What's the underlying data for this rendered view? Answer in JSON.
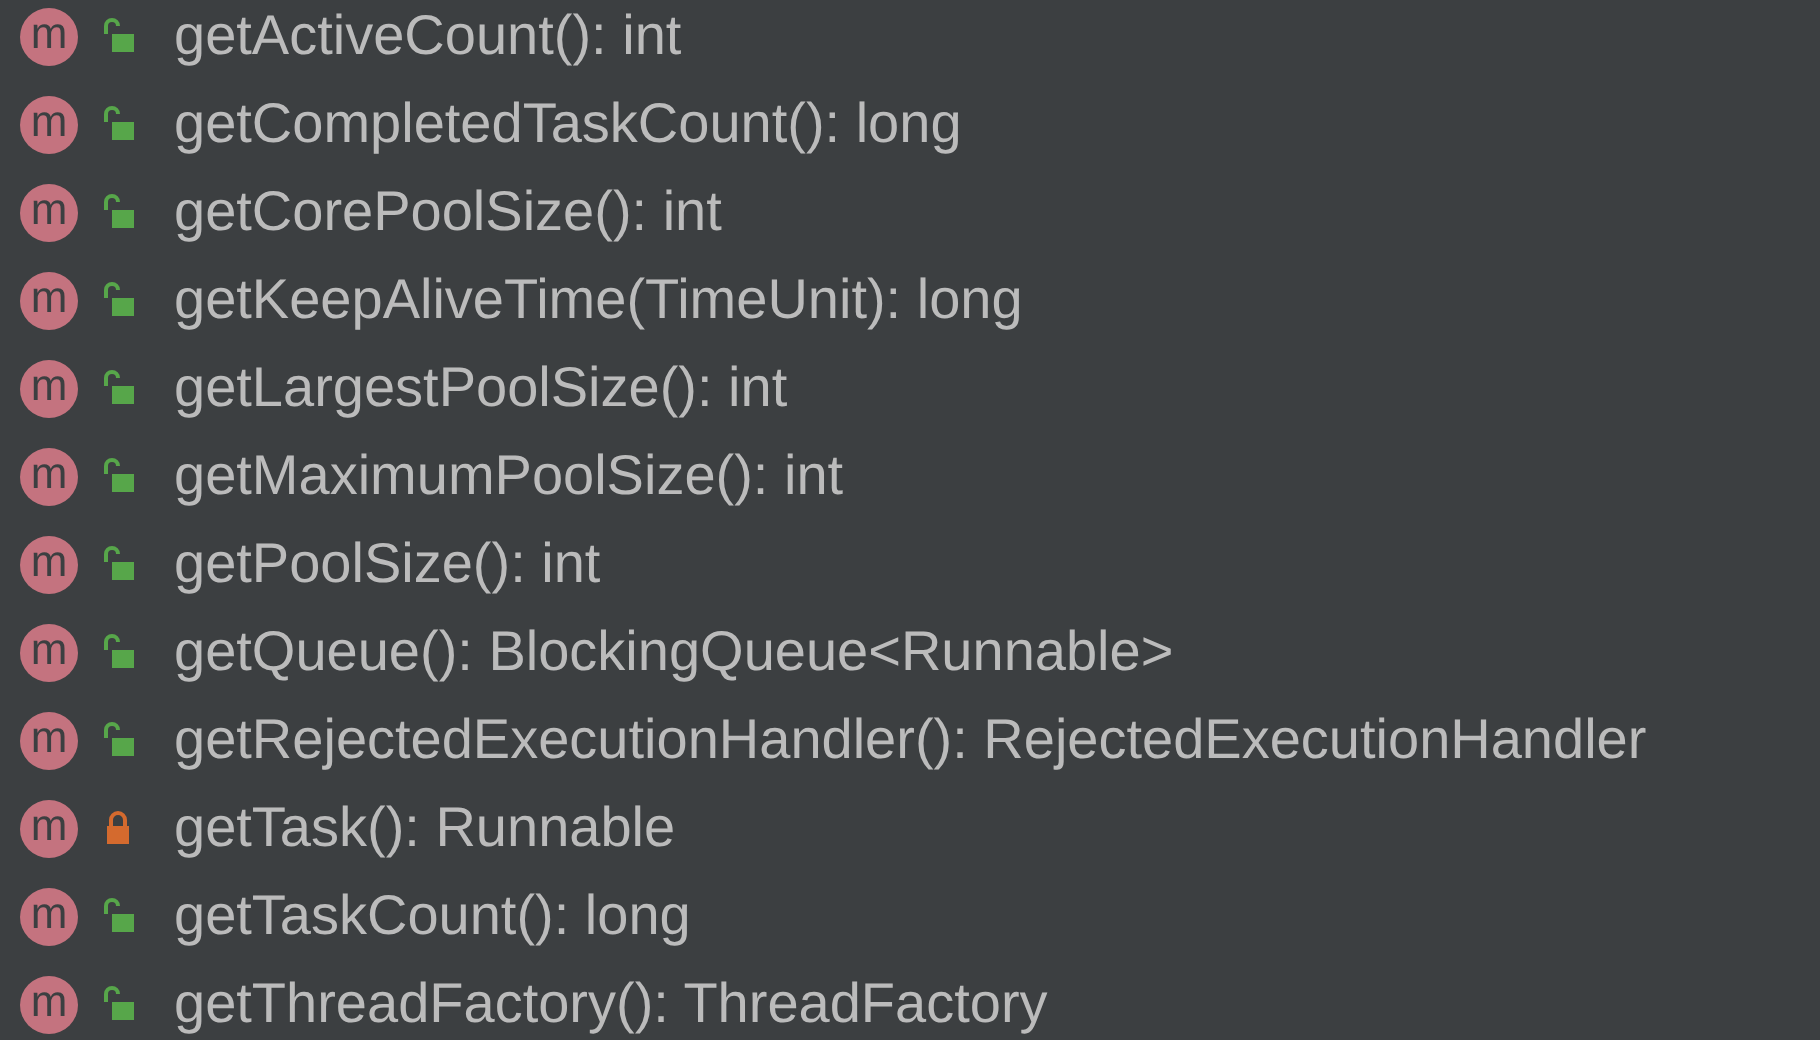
{
  "members": [
    {
      "badge": "m",
      "kind": "public",
      "signature": "getActiveCount(): int"
    },
    {
      "badge": "m",
      "kind": "public",
      "signature": "getCompletedTaskCount(): long"
    },
    {
      "badge": "m",
      "kind": "public",
      "signature": "getCorePoolSize(): int"
    },
    {
      "badge": "m",
      "kind": "public",
      "signature": "getKeepAliveTime(TimeUnit): long"
    },
    {
      "badge": "m",
      "kind": "public",
      "signature": "getLargestPoolSize(): int"
    },
    {
      "badge": "m",
      "kind": "public",
      "signature": "getMaximumPoolSize(): int"
    },
    {
      "badge": "m",
      "kind": "public",
      "signature": "getPoolSize(): int"
    },
    {
      "badge": "m",
      "kind": "public",
      "signature": "getQueue(): BlockingQueue<Runnable>"
    },
    {
      "badge": "m",
      "kind": "public",
      "signature": "getRejectedExecutionHandler(): RejectedExecutionHandler"
    },
    {
      "badge": "m",
      "kind": "private",
      "signature": "getTask(): Runnable"
    },
    {
      "badge": "m",
      "kind": "public",
      "signature": "getTaskCount(): long"
    },
    {
      "badge": "m",
      "kind": "public",
      "signature": "getThreadFactory(): ThreadFactory"
    }
  ]
}
